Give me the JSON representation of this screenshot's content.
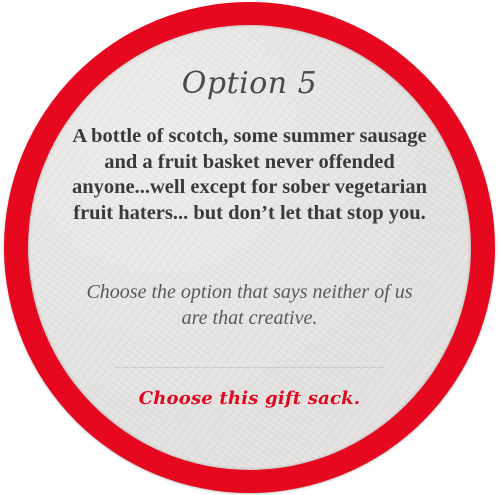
{
  "card": {
    "title": "Option 5",
    "description": "A bottle of scotch, some summer sausage and a fruit basket never offended anyone...well except for sober vegetarian fruit haters... but don’t let that stop you.",
    "subtitle": "Choose the option that says neither of us are that creative.",
    "cta_label": "Choose this gift sack."
  },
  "colors": {
    "ring": "#e5081e",
    "disc": "#e6e4e2",
    "cta": "#e0081e",
    "text": "#3a3a3a"
  }
}
